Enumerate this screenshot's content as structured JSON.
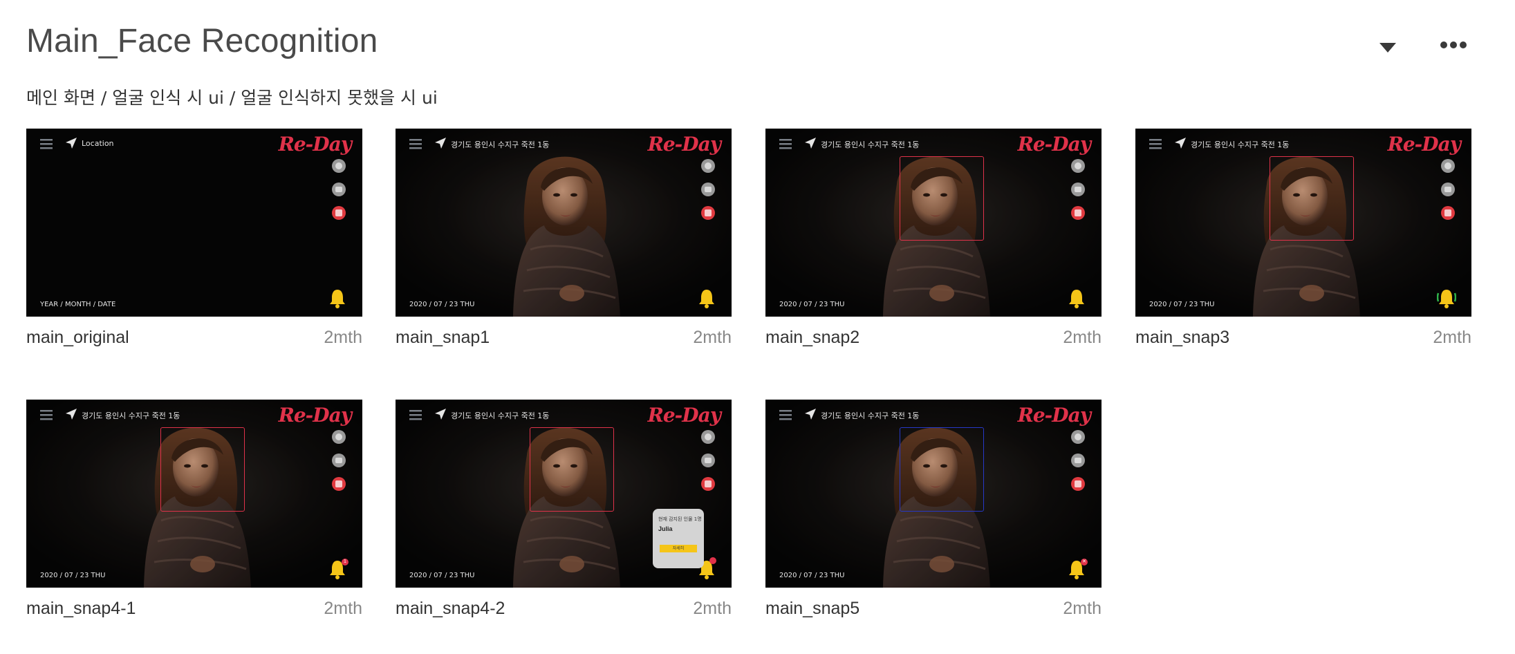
{
  "header": {
    "title": "Main_Face Recognition",
    "subtitle": "메인 화면 / 얼굴 인식 시 ui / 얼굴 인식하지 못했을 시 ui"
  },
  "cards": [
    {
      "name": "main_original",
      "age": "2mth",
      "location": "Location",
      "date": "YEAR / MONTH / DATE",
      "logo": "Re-Day"
    },
    {
      "name": "main_snap1",
      "age": "2mth",
      "location": "경기도 용인시 수지구 죽전 1동",
      "date": "2020 / 07 / 23    THU",
      "logo": "Re-Day"
    },
    {
      "name": "main_snap2",
      "age": "2mth",
      "location": "경기도 용인시 수지구 죽전 1동",
      "date": "2020 / 07 / 23    THU",
      "logo": "Re-Day"
    },
    {
      "name": "main_snap3",
      "age": "2mth",
      "location": "경기도 용인시 수지구 죽전 1동",
      "date": "2020 / 07 / 23    THU",
      "logo": "Re-Day"
    },
    {
      "name": "main_snap4-1",
      "age": "2mth",
      "location": "경기도 용인시 수지구 죽전 1동",
      "date": "2020 / 07 / 23    THU",
      "logo": "Re-Day",
      "badge": "1"
    },
    {
      "name": "main_snap4-2",
      "age": "2mth",
      "location": "경기도 용인시 수지구 죽전 1동",
      "date": "2020 / 07 / 23    THU",
      "logo": "Re-Day",
      "popup": {
        "line": "현재 감지된 인물 1명",
        "name": "Julia",
        "button": "자세히"
      }
    },
    {
      "name": "main_snap5",
      "age": "2mth",
      "location": "경기도 용인시 수지구 죽전 1동",
      "date": "2020 / 07 / 23    THU",
      "logo": "Re-Day",
      "badge": "✕"
    }
  ],
  "colors": {
    "accent_red": "#e0324a",
    "bell_yellow": "#f5c518",
    "facebox_blue": "#2638c8",
    "alert_green": "#2fb34a"
  },
  "icons": {
    "menu": "menu-icon",
    "location": "location-arrow-icon",
    "bell": "bell-icon",
    "dropdown": "caret-down-icon",
    "more": "more-horizontal-icon"
  }
}
